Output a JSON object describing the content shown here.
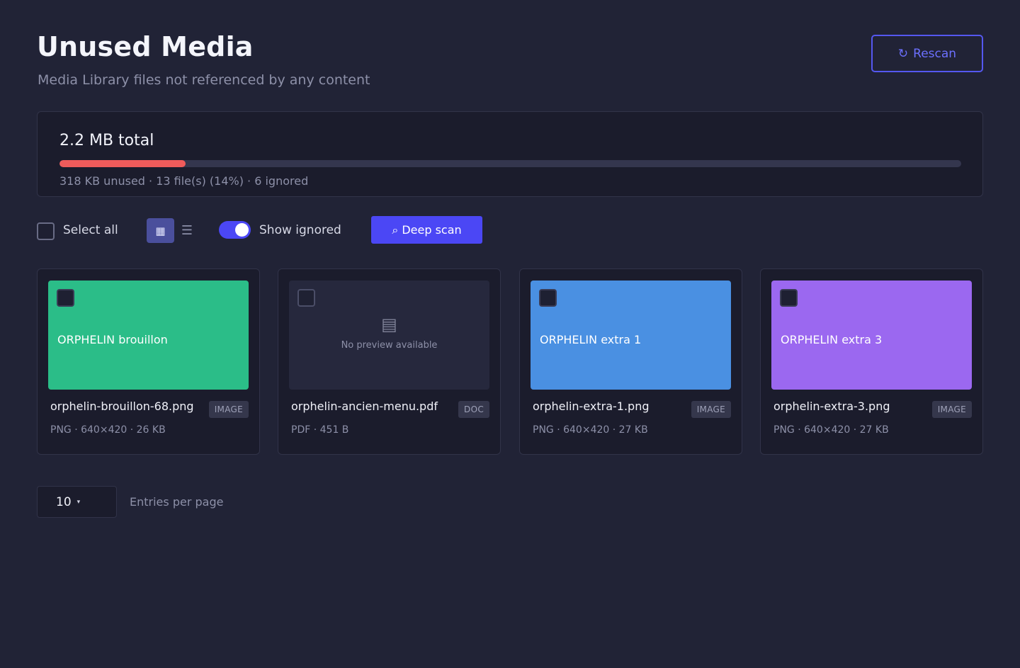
{
  "header": {
    "title": "Unused Media",
    "subtitle": "Media Library files not referenced by any content",
    "rescan_icon": "↻",
    "rescan_label": "Rescan"
  },
  "summary": {
    "total": "2.2 MB total",
    "unused_fraction": 0.14,
    "stats": "318 KB unused · 13 file(s) (14%) · 6 ignored",
    "bar_color": "#ef5b5b"
  },
  "toolbar": {
    "select_all_label": "Select all",
    "grid_icon": "▦",
    "list_icon": "☰",
    "show_ignored_label": "Show ignored",
    "show_ignored_on": true,
    "deep_scan_icon": "⌕",
    "deep_scan_label": "Deep scan"
  },
  "cards": [
    {
      "thumb_label": "ORPHELIN brouillon",
      "thumb_color": "#2bbd88",
      "name": "orphelin-brouillon-68.png",
      "badge": "IMAGE",
      "meta": "PNG · 640×420 · 26 KB"
    },
    {
      "no_preview": true,
      "no_preview_icon": "▤",
      "no_preview_text": "No preview available",
      "name": "orphelin-ancien-menu.pdf",
      "badge": "DOC",
      "meta": "PDF · 451 B"
    },
    {
      "thumb_label": "ORPHELIN extra 1",
      "thumb_color": "#4a90e2",
      "name": "orphelin-extra-1.png",
      "badge": "IMAGE",
      "meta": "PNG · 640×420 · 27 KB"
    },
    {
      "thumb_label": "ORPHELIN extra 3",
      "thumb_color": "#9b68f0",
      "name": "orphelin-extra-3.png",
      "badge": "IMAGE",
      "meta": "PNG · 640×420 · 27 KB"
    }
  ],
  "pagination": {
    "per_page": "10",
    "per_page_arrow": "▾",
    "per_page_label": "Entries per page"
  }
}
